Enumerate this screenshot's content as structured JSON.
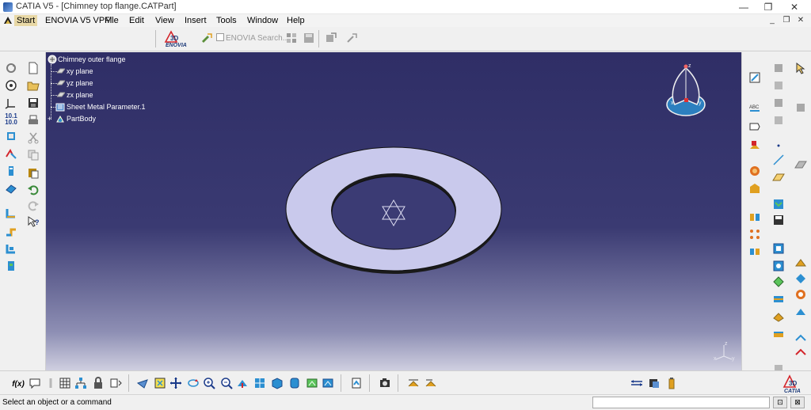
{
  "window": {
    "title": "CATIA V5 - [Chimney top flange.CATPart]",
    "minimize": "—",
    "restore": "❐",
    "close": "✕"
  },
  "menubar": {
    "start": "Start",
    "enovia_vpm": "ENOVIA V5 VPM",
    "file": "File",
    "edit": "Edit",
    "view": "View",
    "insert": "Insert",
    "tools": "Tools",
    "window": "Window",
    "help": "Help",
    "doc_minimize": "_",
    "doc_restore": "❐",
    "doc_close": "✕"
  },
  "top_toolbar": {
    "enovia_logo_text": "ENOVIA",
    "enovia_search_label": "ENOVIA Search..."
  },
  "spec_tree": {
    "root": "Chimney outer flange",
    "items": [
      {
        "label": "xy plane"
      },
      {
        "label": "yz plane"
      },
      {
        "label": "zx plane"
      },
      {
        "label": "Sheet Metal Parameter.1"
      },
      {
        "label": "PartBody"
      }
    ]
  },
  "compass": {
    "x_label": "x",
    "y_label": "y",
    "z_label": "z"
  },
  "axis_triad": {
    "x_label": "x",
    "y_label": "y",
    "z_label": "z"
  },
  "bottom_toolbar": {
    "formula_label": "f(x)"
  },
  "status_bar": {
    "message": "Select an object or a command"
  },
  "colors": {
    "viewport_top": "#2f2e66",
    "viewport_bottom": "#cfcfe0",
    "part_fill": "#c9c9ec",
    "start_menu_bg": "#e8d8a6"
  }
}
